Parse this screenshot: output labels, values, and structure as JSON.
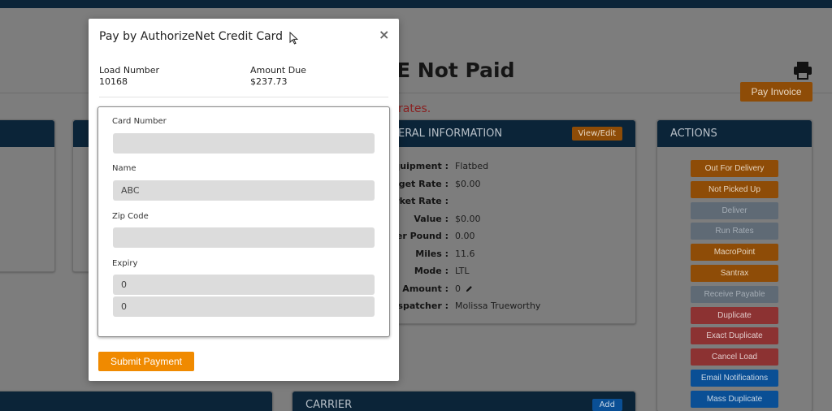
{
  "background": {
    "page_title": "E Not Paid",
    "rates_text": "rates.",
    "pay_invoice_label": "Pay Invoice",
    "general_info": {
      "header": "ERAL INFORMATION",
      "view_edit_label": "View/Edit",
      "rows": [
        {
          "label": "Equipment :",
          "value": "Flatbed"
        },
        {
          "label": "arget Rate :",
          "value": "$0.00"
        },
        {
          "label": "arket Rate :",
          "value": ""
        },
        {
          "label": "Value :",
          "value": "$0.00"
        },
        {
          "label": "Per Pound :",
          "value": "0.00"
        },
        {
          "label": "Miles :",
          "value": "11.6"
        },
        {
          "label": "Mode :",
          "value": "LTL"
        },
        {
          "label": "D Amount :",
          "value": "0"
        },
        {
          "label": "Dispatcher :",
          "value": "Molissa Trueworthy"
        }
      ]
    },
    "actions": {
      "header": "ACTIONS",
      "buttons": [
        {
          "label": "Out For Delivery",
          "color": "orange"
        },
        {
          "label": "Not Picked Up",
          "color": "orange"
        },
        {
          "label": "Deliver",
          "color": "grey"
        },
        {
          "label": "Run Rates",
          "color": "grey"
        },
        {
          "label": "MacroPoint",
          "color": "orange"
        },
        {
          "label": "Santrax",
          "color": "orange"
        },
        {
          "label": "Receive Payable",
          "color": "grey"
        },
        {
          "label": "Duplicate",
          "color": "red"
        },
        {
          "label": "Exact Duplicate",
          "color": "red"
        },
        {
          "label": "Cancel Load",
          "color": "red"
        },
        {
          "label": "Email Notifications",
          "color": "blue"
        },
        {
          "label": "Mass Duplicate",
          "color": "blue"
        }
      ]
    },
    "carrier": {
      "header": "CARRIER",
      "add_label": "Add"
    }
  },
  "modal": {
    "title": "Pay by AuthorizeNet Credit Card",
    "close_symbol": "×",
    "load_number_label": "Load Number",
    "load_number": "10168",
    "amount_due_label": "Amount Due",
    "amount_due": "$237.73",
    "fields": {
      "card_number_label": "Card Number",
      "card_number_value": "",
      "name_label": "Name",
      "name_value": "ABC",
      "zip_label": "Zip Code",
      "zip_value": "",
      "expiry_label": "Expiry",
      "expiry_month": "0",
      "expiry_year": "0"
    },
    "submit_label": "Submit Payment"
  },
  "colors": {
    "navy": "#0b2438",
    "orange": "#f08a00",
    "overlay_grey": "#7d7d7d"
  }
}
